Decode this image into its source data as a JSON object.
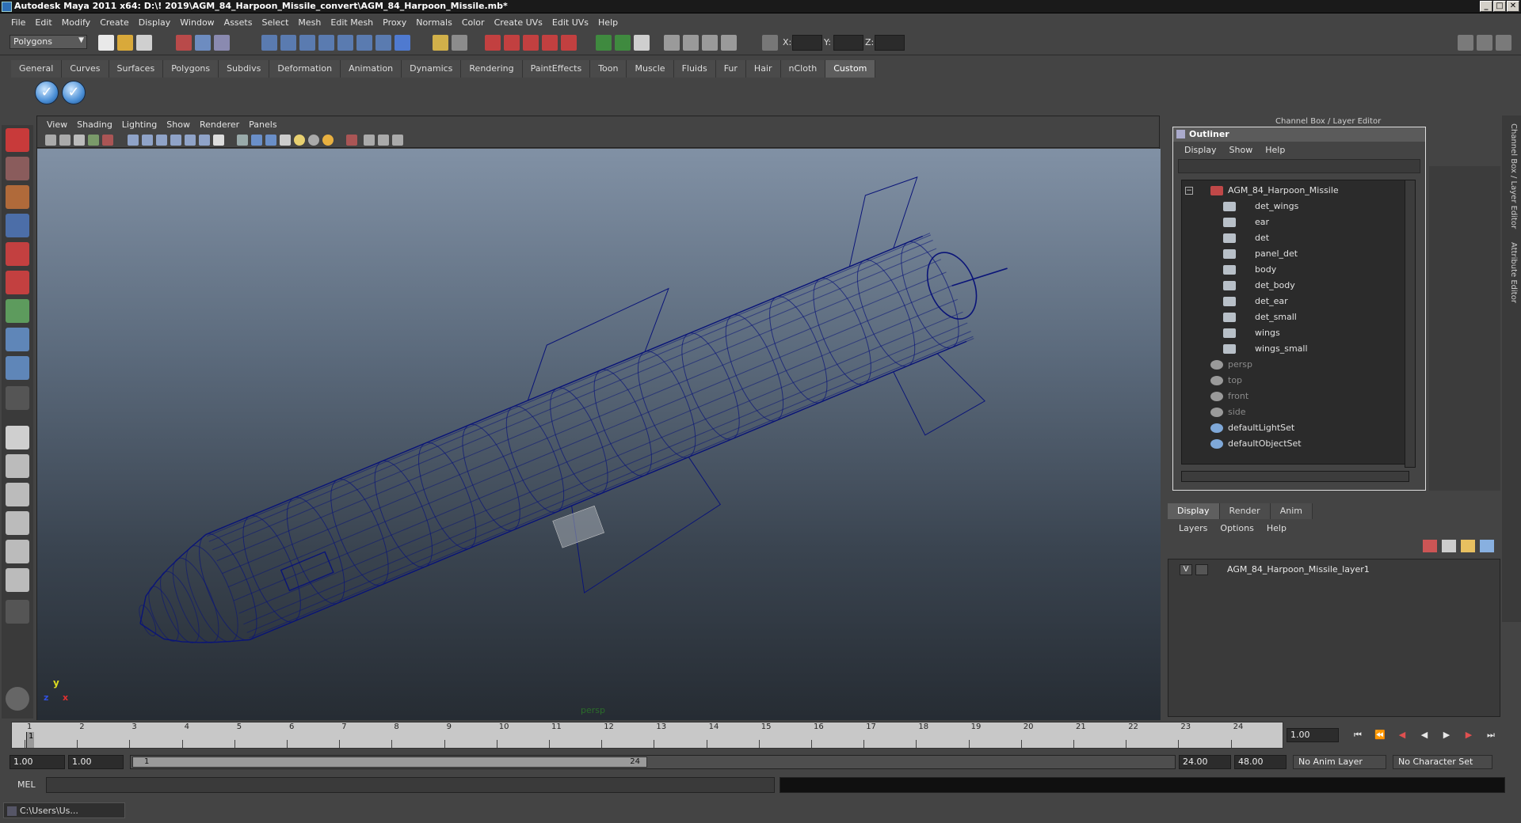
{
  "window": {
    "title": "Autodesk Maya 2011 x64: D:\\! 2019\\AGM_84_Harpoon_Missile_convert\\AGM_84_Harpoon_Missile.mb*",
    "min": "_",
    "max": "□",
    "close": "✕"
  },
  "menubar": [
    "File",
    "Edit",
    "Modify",
    "Create",
    "Display",
    "Window",
    "Assets",
    "Select",
    "Mesh",
    "Edit Mesh",
    "Proxy",
    "Normals",
    "Color",
    "Create UVs",
    "Edit UVs",
    "Help"
  ],
  "status": {
    "mode": "Polygons",
    "x_label": "X:",
    "y_label": "Y:",
    "z_label": "Z:"
  },
  "shelf": {
    "tabs": [
      "General",
      "Curves",
      "Surfaces",
      "Polygons",
      "Subdivs",
      "Deformation",
      "Animation",
      "Dynamics",
      "Rendering",
      "PaintEffects",
      "Toon",
      "Muscle",
      "Fluids",
      "Fur",
      "Hair",
      "nCloth",
      "Custom"
    ],
    "active": "Custom"
  },
  "viewport": {
    "menu": [
      "View",
      "Shading",
      "Lighting",
      "Show",
      "Renderer",
      "Panels"
    ],
    "camera": "persp",
    "axes": {
      "x": "x",
      "y": "y",
      "z": "z"
    },
    "wireframe_color": "#0a1478"
  },
  "channel_box_title": "Channel Box / Layer Editor",
  "side_tabs": [
    "Channel Box / Layer Editor",
    "Attribute Editor"
  ],
  "outliner": {
    "title": "Outliner",
    "menu": [
      "Display",
      "Show",
      "Help"
    ],
    "items": [
      {
        "label": "AGM_84_Harpoon_Missile",
        "kind": "group",
        "dim": false
      },
      {
        "label": "det_wings",
        "kind": "mesh",
        "dim": false
      },
      {
        "label": "ear",
        "kind": "mesh",
        "dim": false
      },
      {
        "label": "det",
        "kind": "mesh",
        "dim": false
      },
      {
        "label": "panel_det",
        "kind": "mesh",
        "dim": false
      },
      {
        "label": "body",
        "kind": "mesh",
        "dim": false
      },
      {
        "label": "det_body",
        "kind": "mesh",
        "dim": false
      },
      {
        "label": "det_ear",
        "kind": "mesh",
        "dim": false
      },
      {
        "label": "det_small",
        "kind": "mesh",
        "dim": false
      },
      {
        "label": "wings",
        "kind": "mesh",
        "dim": false
      },
      {
        "label": "wings_small",
        "kind": "mesh",
        "dim": false
      },
      {
        "label": "persp",
        "kind": "camera",
        "dim": true
      },
      {
        "label": "top",
        "kind": "camera",
        "dim": true
      },
      {
        "label": "front",
        "kind": "camera",
        "dim": true
      },
      {
        "label": "side",
        "kind": "camera",
        "dim": true
      },
      {
        "label": "defaultLightSet",
        "kind": "set",
        "dim": false
      },
      {
        "label": "defaultObjectSet",
        "kind": "set",
        "dim": false
      }
    ]
  },
  "layer_editor": {
    "tabs": [
      "Display",
      "Render",
      "Anim"
    ],
    "active": "Display",
    "menu": [
      "Layers",
      "Options",
      "Help"
    ],
    "layers": [
      {
        "visible": "V",
        "name": "AGM_84_Harpoon_Missile_layer1"
      }
    ]
  },
  "timeline": {
    "ticks": [
      "1",
      "2",
      "3",
      "4",
      "5",
      "6",
      "7",
      "8",
      "9",
      "10",
      "11",
      "12",
      "13",
      "14",
      "15",
      "16",
      "17",
      "18",
      "19",
      "20",
      "21",
      "22",
      "23",
      "24"
    ],
    "current_frame": "1",
    "current_time": "1.00"
  },
  "range": {
    "start": "1.00",
    "anim_start": "1.00",
    "range_start": "1",
    "range_end": "24",
    "anim_end": "24.00",
    "end": "48.00",
    "anim_layer": "No Anim Layer",
    "char_set": "No Character Set"
  },
  "cmdline": {
    "label": "MEL"
  },
  "taskbar": {
    "item": "C:\\Users\\Us..."
  }
}
